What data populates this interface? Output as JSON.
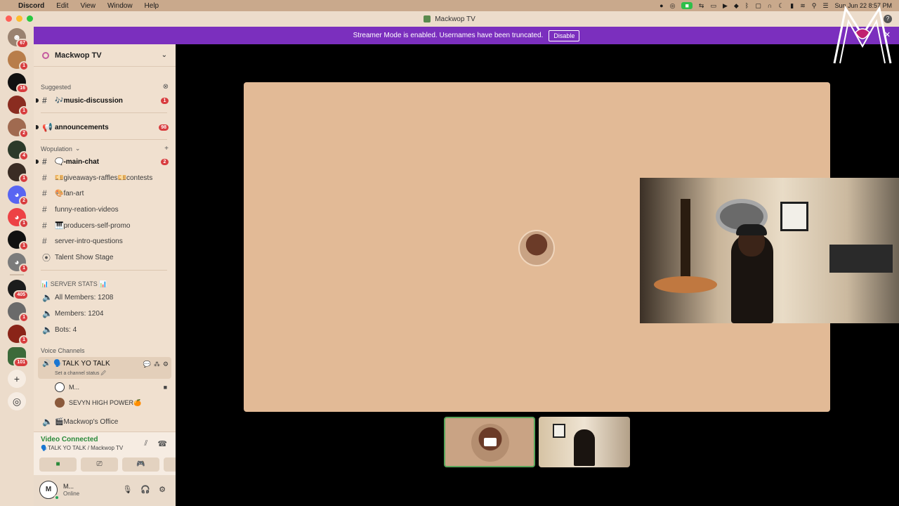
{
  "menubar": {
    "app": "Discord",
    "items": [
      "Edit",
      "View",
      "Window",
      "Help"
    ],
    "clock": "Sun Jun 22  8:57 PM"
  },
  "window": {
    "title": "Mackwop TV"
  },
  "banner": {
    "text": "Streamer Mode is enabled. Usernames have been truncated.",
    "button": "Disable"
  },
  "rail": {
    "badges": [
      "67",
      "1",
      "16",
      "1",
      "2",
      "4",
      "1",
      "2",
      "1",
      "1",
      "1",
      "405",
      "1",
      "1",
      "101"
    ]
  },
  "server": {
    "name": "Mackwop TV"
  },
  "suggested": {
    "label": "Suggested",
    "channel": {
      "name": "🎶music-discussion",
      "badge": "1"
    }
  },
  "announcements": {
    "name": "announcements",
    "badge": "98"
  },
  "wopulation": {
    "label": "Wopulation",
    "channels": [
      {
        "name": "🗨️-main-chat",
        "badge": "2"
      },
      {
        "name": "💴giveaways-raffles💴contests"
      },
      {
        "name": "🎨fan-art"
      },
      {
        "name": "funny-reation-videos"
      },
      {
        "name": "🎹producers-self-promo"
      },
      {
        "name": "server-intro-questions"
      },
      {
        "name": "Talent Show Stage"
      }
    ]
  },
  "stats": {
    "label": "📊 SERVER STATS 📊",
    "items": [
      "All Members: 1208",
      "Members: 1204",
      "Bots: 4"
    ]
  },
  "voice": {
    "label": "Voice Channels",
    "active": {
      "name": "🗣️TALK YO TALK",
      "status": "Set a channel status 🖉"
    },
    "members": [
      "M...",
      "SEVYN HIGH POWER🍊"
    ],
    "office": "🎬Mackwop's Office"
  },
  "connection": {
    "status": "Video Connected",
    "location": "🗣️TALK YO TALK / Mackwop TV"
  },
  "user": {
    "name": "M...",
    "status": "Online"
  },
  "colors": {
    "accent": "#7b2fbe",
    "connected": "#2a8a3a",
    "badge": "#d83c3e",
    "tile": "#e2ba96"
  }
}
